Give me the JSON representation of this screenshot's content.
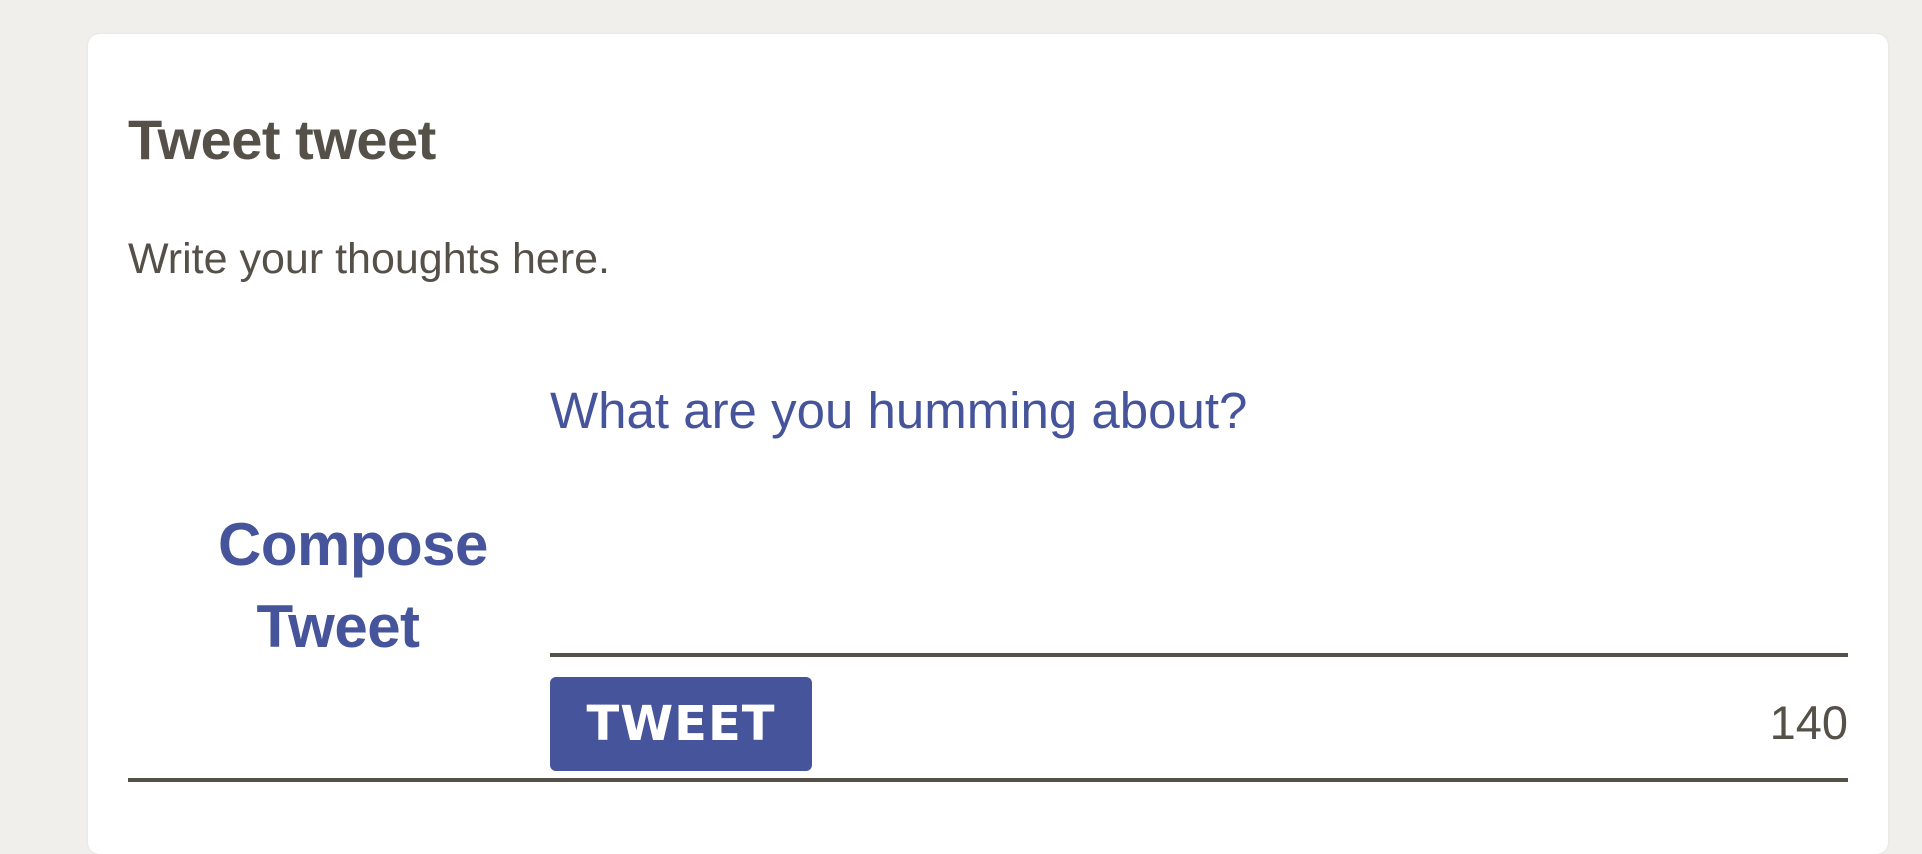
{
  "header": {
    "title": "Tweet tweet",
    "subtitle": "Write your thoughts here."
  },
  "composer": {
    "label": "Compose Tweet",
    "placeholder": "What are you humming about?",
    "value": "",
    "button_label": "TWEET",
    "char_count": "140"
  },
  "colors": {
    "accent": "#46549b",
    "text": "#555149",
    "background": "#f0efeb",
    "card": "#ffffff"
  }
}
